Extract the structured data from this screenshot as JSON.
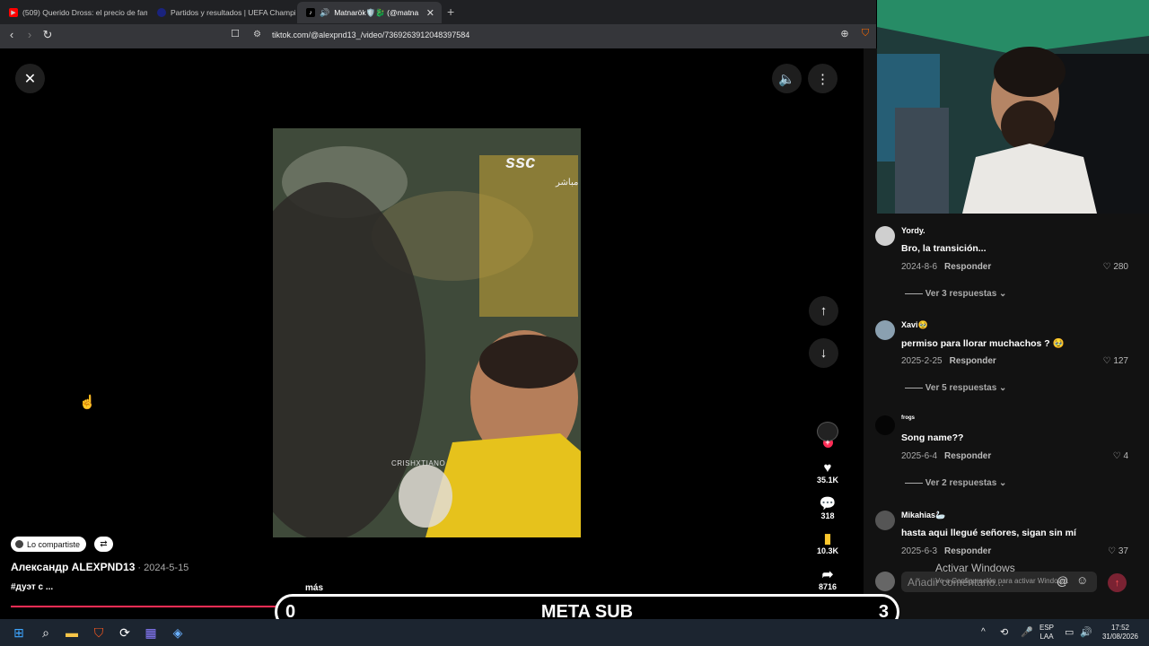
{
  "browser": {
    "tabs": [
      {
        "label": "(509) Querido Dross: el precio de fam",
        "icon": "youtube-icon",
        "color": "#ff0000"
      },
      {
        "label": "Partidos y resultados | UEFA Champi",
        "icon": "uefa-icon",
        "color": "#1a237e"
      },
      {
        "label": "Matnarök🛡️🐉 (@matna",
        "icon": "tiktok-icon",
        "color": "#ffffff",
        "active": true
      }
    ],
    "url": "tiktok.com/@alexpnd13_/video/7369263912048397584",
    "new_tab": "+",
    "close": "✕"
  },
  "video": {
    "overlay_logo": "ssc",
    "overlay_sub": "مباشر",
    "watermark": "CRISHXTIANO",
    "likes": "35.1K",
    "comments": "318",
    "saves": "10.3K",
    "shares": "8716",
    "progress": 0.32
  },
  "post": {
    "shared_label": "Lo compartiste",
    "author": "Александр ALEXPND13",
    "date": " · 2024-5-15",
    "tags": "#дуэт с ...",
    "more": "más"
  },
  "overlay": {
    "left_score": "0",
    "title": "META SUB",
    "right_score": "3"
  },
  "comments": [
    {
      "user": "Yordy.",
      "text": "Bro, la transición...",
      "date": "2024-8-6",
      "reply": "Responder",
      "likes": "280",
      "more": "Ver 3 respuestas"
    },
    {
      "user": "Xavi🥹",
      "text": "permiso para llorar muchachos ? 🥹",
      "date": "2025-2-25",
      "reply": "Responder",
      "likes": "127",
      "more": "Ver 5 respuestas"
    },
    {
      "user": "frogs",
      "text": "Song name??",
      "date": "2025-6-4",
      "reply": "Responder",
      "likes": "4",
      "more": "Ver 2 respuestas"
    },
    {
      "user": "Mikahias🦢",
      "text": "hasta aqui llegué señores, sigan sin mí",
      "date": "2025-6-3",
      "reply": "Responder",
      "likes": "37",
      "more": ""
    }
  ],
  "comment_input": {
    "placeholder": "Añadir comentario..."
  },
  "windows_activation": {
    "title": "Activar Windows",
    "subtitle": "Ve a Configuración para activar Windows."
  },
  "taskbar": {
    "lang_top": "ESP",
    "lang_bottom": "LAA",
    "time": "17:52",
    "date": "31/08/2026"
  }
}
